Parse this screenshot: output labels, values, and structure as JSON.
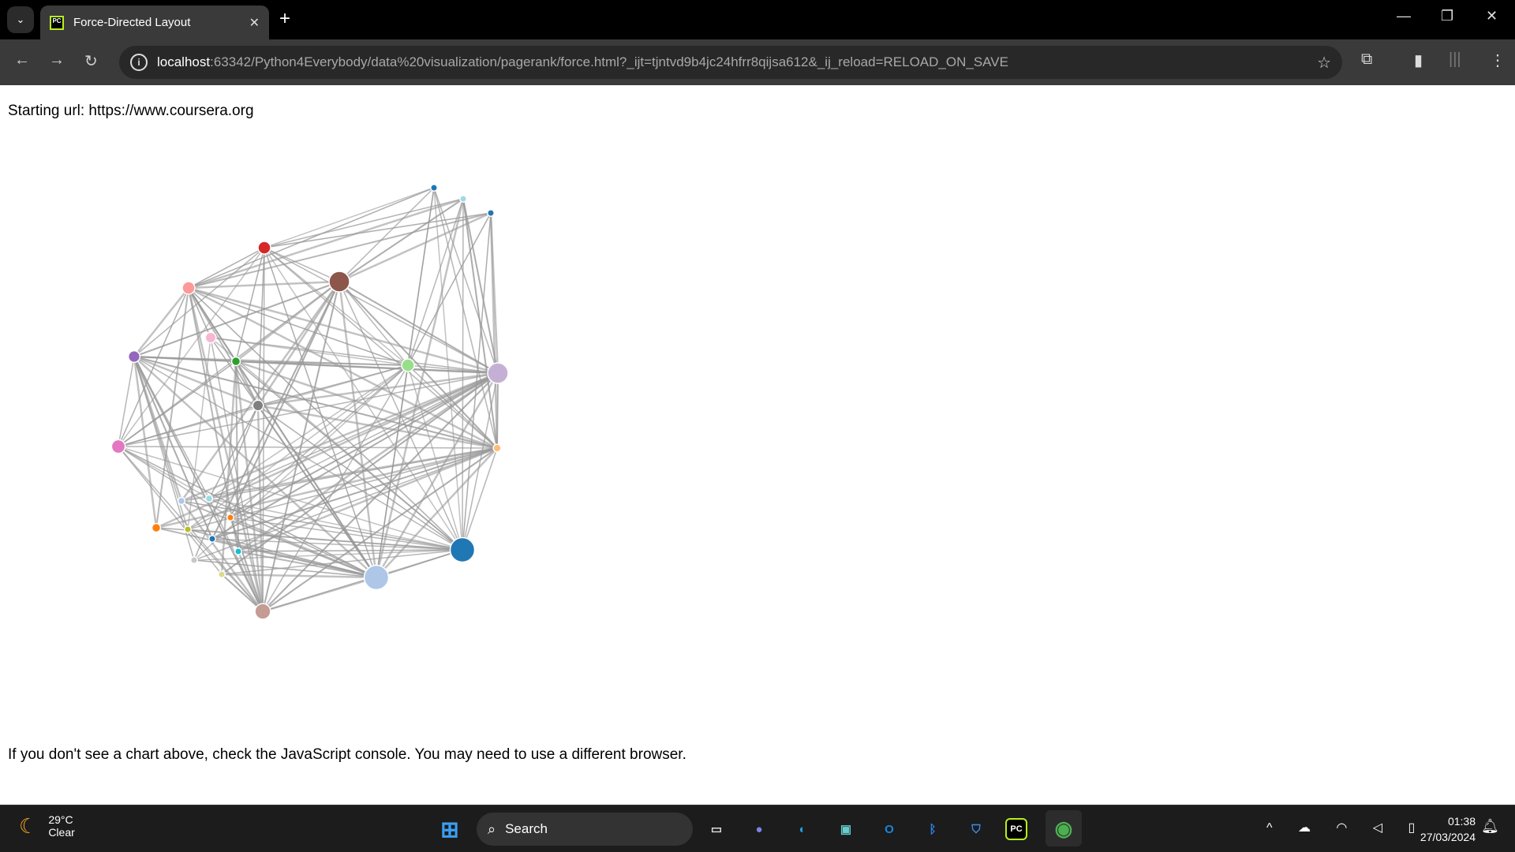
{
  "browser": {
    "tab_title": "Force-Directed Layout",
    "url_host": "localhost",
    "url_rest": ":63342/Python4Everybody/data%20visualization/pagerank/force.html?_ijt=tjntvd9b4jc24hfrr8qijsa612&_ij_reload=RELOAD_ON_SAVE"
  },
  "page": {
    "starting_url_text": "Starting url: https://www.coursera.org",
    "footer_text": "If you don't see a chart above, check the JavaScript console. You may need to use a different browser."
  },
  "graph": {
    "link_color": "#999999",
    "nodes": [
      {
        "color": "#1f77b4",
        "rank": 1
      },
      {
        "color": "#9edae5",
        "rank": 1
      },
      {
        "color": "#1f77b4",
        "rank": 1
      },
      {
        "color": "#d62728",
        "rank": 4
      },
      {
        "color": "#8c564b",
        "rank": 8
      },
      {
        "color": "#ff9896",
        "rank": 4
      },
      {
        "color": "#f7b6d2",
        "rank": 3
      },
      {
        "color": "#9467bd",
        "rank": 3.5
      },
      {
        "color": "#2ca02c",
        "rank": 2
      },
      {
        "color": "#98df8a",
        "rank": 4
      },
      {
        "color": "#c5b0d5",
        "rank": 8
      },
      {
        "color": "#7f7f7f",
        "rank": 3
      },
      {
        "color": "#e377c2",
        "rank": 4.5
      },
      {
        "color": "#ffbb78",
        "rank": 1.5
      },
      {
        "color": "#aec7e8",
        "rank": 1.2
      },
      {
        "color": "#9edae5",
        "rank": 1.2
      },
      {
        "color": "#ff7f0e",
        "rank": 1
      },
      {
        "color": "#ff7f0e",
        "rank": 2
      },
      {
        "color": "#bcbd22",
        "rank": 1
      },
      {
        "color": "#1f77b4",
        "rank": 1
      },
      {
        "color": "#17becf",
        "rank": 1
      },
      {
        "color": "#c7c7c7",
        "rank": 1
      },
      {
        "color": "#dbdb8d",
        "rank": 1
      },
      {
        "color": "#aec7e8",
        "rank": 10
      },
      {
        "color": "#1f77b4",
        "rank": 10
      },
      {
        "color": "#c49c94",
        "rank": 5.5
      }
    ],
    "adjacency": {
      "3": [
        4,
        5,
        7,
        8,
        9,
        10,
        11,
        12,
        13,
        23,
        24,
        25,
        0,
        1,
        2
      ],
      "4": [
        5,
        7,
        8,
        9,
        10,
        11,
        12,
        13,
        23,
        24,
        25,
        0,
        1,
        2,
        14,
        16,
        19
      ],
      "5": [
        7,
        8,
        9,
        10,
        11,
        12,
        13,
        23,
        24,
        25,
        0,
        1,
        2,
        6,
        17,
        20
      ],
      "7": [
        8,
        9,
        10,
        11,
        12,
        13,
        23,
        24,
        25,
        14,
        15,
        17,
        18,
        19,
        21
      ],
      "8": [
        9,
        10,
        11,
        12,
        13,
        23,
        24,
        25,
        20,
        22
      ],
      "9": [
        10,
        11,
        12,
        13,
        23,
        24,
        25,
        0,
        1,
        2,
        15,
        16,
        18,
        21
      ],
      "10": [
        11,
        12,
        13,
        23,
        24,
        25,
        0,
        1,
        2,
        14,
        15,
        16,
        17,
        18,
        19,
        20,
        22
      ],
      "11": [
        12,
        13,
        23,
        24,
        25,
        15,
        21
      ],
      "12": [
        13,
        23,
        24,
        25,
        15,
        16,
        22
      ],
      "13": [
        23,
        24,
        25,
        0,
        1,
        2,
        14,
        15,
        17,
        18,
        19,
        20,
        21
      ],
      "23": [
        24,
        25,
        0,
        1,
        14,
        15,
        16,
        17,
        18,
        19,
        20,
        21,
        22,
        6
      ],
      "24": [
        25,
        0,
        1,
        2,
        14,
        15,
        16,
        17,
        18,
        19,
        20,
        21,
        22,
        6
      ],
      "25": [
        14,
        15,
        16,
        18,
        20,
        22,
        6
      ],
      "6": [
        10,
        9,
        18
      ]
    }
  },
  "taskbar": {
    "temperature": "29°C",
    "weather": "Clear",
    "search_label": "Search",
    "time": "01:38",
    "date": "27/03/2024"
  }
}
